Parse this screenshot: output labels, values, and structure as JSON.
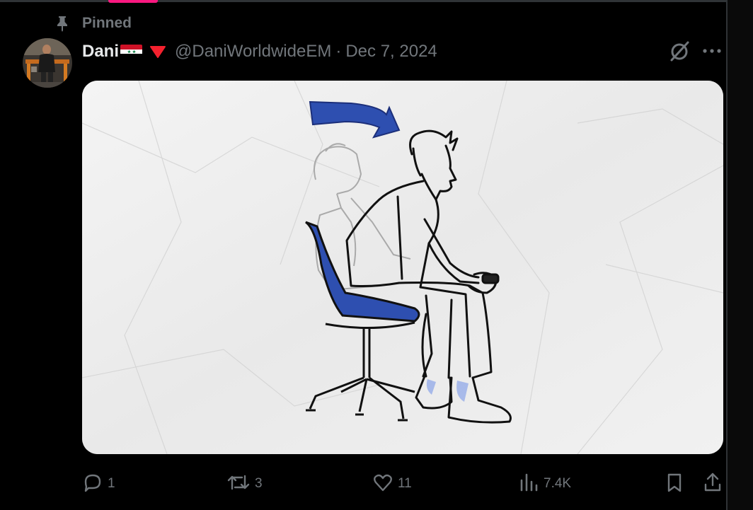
{
  "pinned": {
    "label": "Pinned"
  },
  "post": {
    "display_name": "Dani",
    "handle": "@DaniWorldwideEM",
    "separator": "·",
    "date": "Dec 7, 2024"
  },
  "actions": {
    "replies": "1",
    "reposts": "3",
    "likes": "11",
    "views": "7.4K"
  },
  "colors": {
    "accent": "#f91880",
    "muted": "#71767b",
    "text": "#e7e9ea",
    "chair_blue": "#2e4fb0",
    "badge_red": "#f4212e"
  },
  "icons": [
    "pin-icon",
    "flag-icon",
    "verified-badge-icon",
    "grok-icon",
    "more-icon",
    "reply-icon",
    "repost-icon",
    "like-icon",
    "views-icon",
    "bookmark-icon",
    "share-icon"
  ]
}
